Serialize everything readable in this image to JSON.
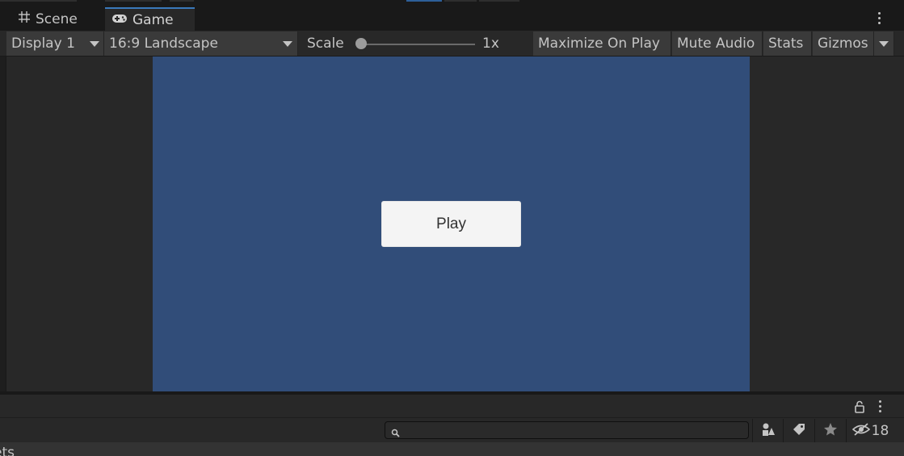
{
  "tabs": {
    "scene": {
      "label": "Scene",
      "icon": "grid-icon"
    },
    "game": {
      "label": "Game",
      "icon": "gamepad-icon",
      "active": true
    }
  },
  "toolbar": {
    "display": "Display 1",
    "aspect": "16:9 Landscape",
    "scale_label": "Scale",
    "scale_value": "1x",
    "maximize_on_play": "Maximize On Play",
    "mute_audio": "Mute Audio",
    "stats": "Stats",
    "gizmos": "Gizmos"
  },
  "game_view": {
    "background_color": "#314d79",
    "play_button_label": "Play"
  },
  "bottom_panel": {
    "search_placeholder": "",
    "hidden_count": "18",
    "content_text": "ets"
  },
  "colors": {
    "accent": "#3a79bb",
    "editor_bg": "#282828",
    "control_bg": "#3a3a3a"
  }
}
